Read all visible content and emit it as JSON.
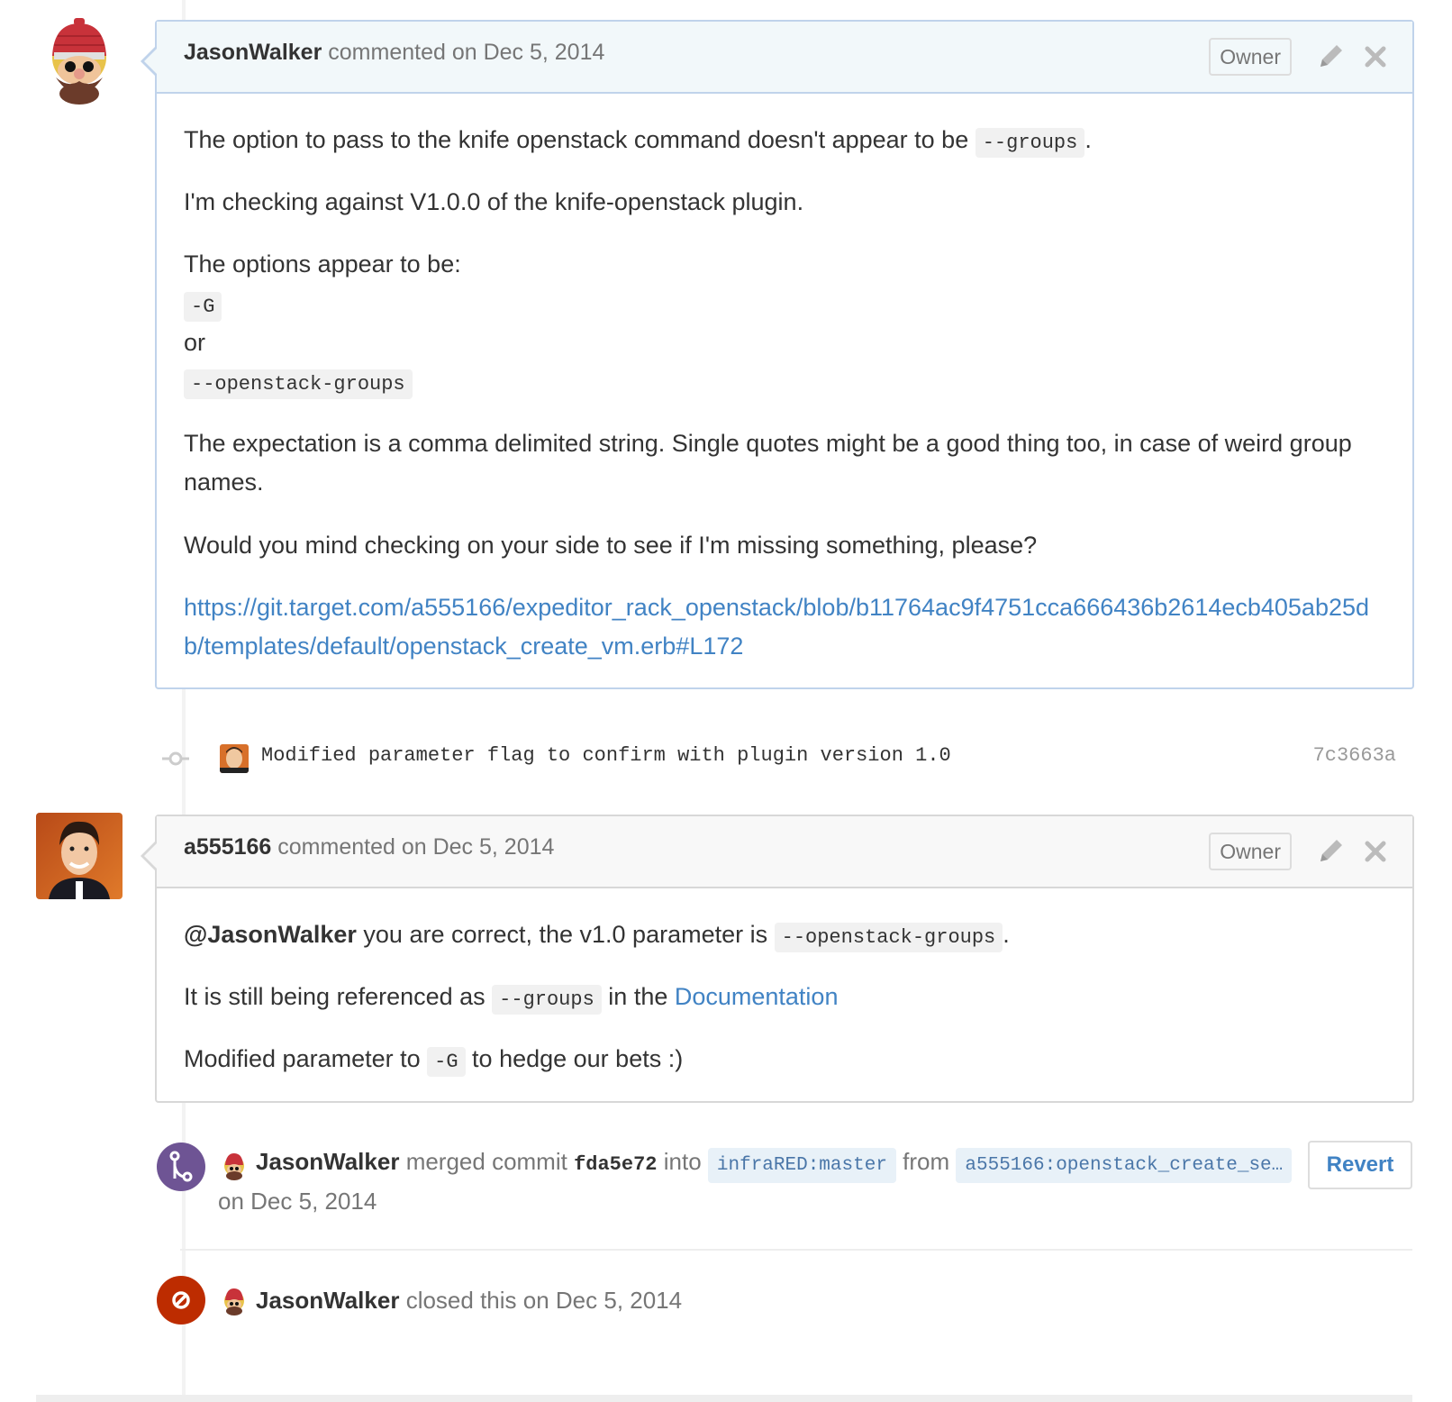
{
  "comment1": {
    "author": "JasonWalker",
    "meta": "commented on Dec 5, 2014",
    "badge": "Owner",
    "p1_before": "The option to pass to the knife openstack command doesn't appear to be ",
    "p1_code": "--groups",
    "p1_after": ".",
    "p2": "I'm checking against V1.0.0 of the knife-openstack plugin.",
    "p3_line1": "The options appear to be:",
    "p3_code1": "-G",
    "p3_or": "or",
    "p3_code2": "--openstack-groups",
    "p4": "The expectation is a comma delimited string. Single quotes might be a good thing too, in case of weird group names.",
    "p5": "Would you mind checking on your side to see if I'm missing something, please?",
    "link": "https://git.target.com/a555166/expeditor_rack_openstack/blob/b11764ac9f4751cca666436b2614ecb405ab25db/templates/default/openstack_create_vm.erb#L172"
  },
  "commit": {
    "message": "Modified parameter flag to confirm with plugin version 1.0",
    "sha": "7c3663a"
  },
  "comment2": {
    "author": "a555166",
    "meta": "commented on Dec 5, 2014",
    "badge": "Owner",
    "mention": "@JasonWalker",
    "p1_mid": " you are correct, the v1.0 parameter is ",
    "p1_code": "--openstack-groups",
    "p1_after": ".",
    "p2_before": "It is still being referenced as ",
    "p2_code": "--groups",
    "p2_mid": " in the ",
    "p2_link": "Documentation",
    "p3_before": "Modified parameter to ",
    "p3_code": "-G",
    "p3_after": " to hedge our bets :)"
  },
  "merge_event": {
    "author": "JasonWalker",
    "text1": "merged commit",
    "sha": "fda5e72",
    "into": "into",
    "base_branch": "infraRED:master",
    "from": "from",
    "head_branch": "a555166:openstack_create_se…",
    "date": "on Dec 5, 2014",
    "revert_label": "Revert",
    "badge_color": "#6e5494"
  },
  "close_event": {
    "author": "JasonWalker",
    "text": "closed this on Dec 5, 2014",
    "badge_color": "#bd2c00"
  }
}
